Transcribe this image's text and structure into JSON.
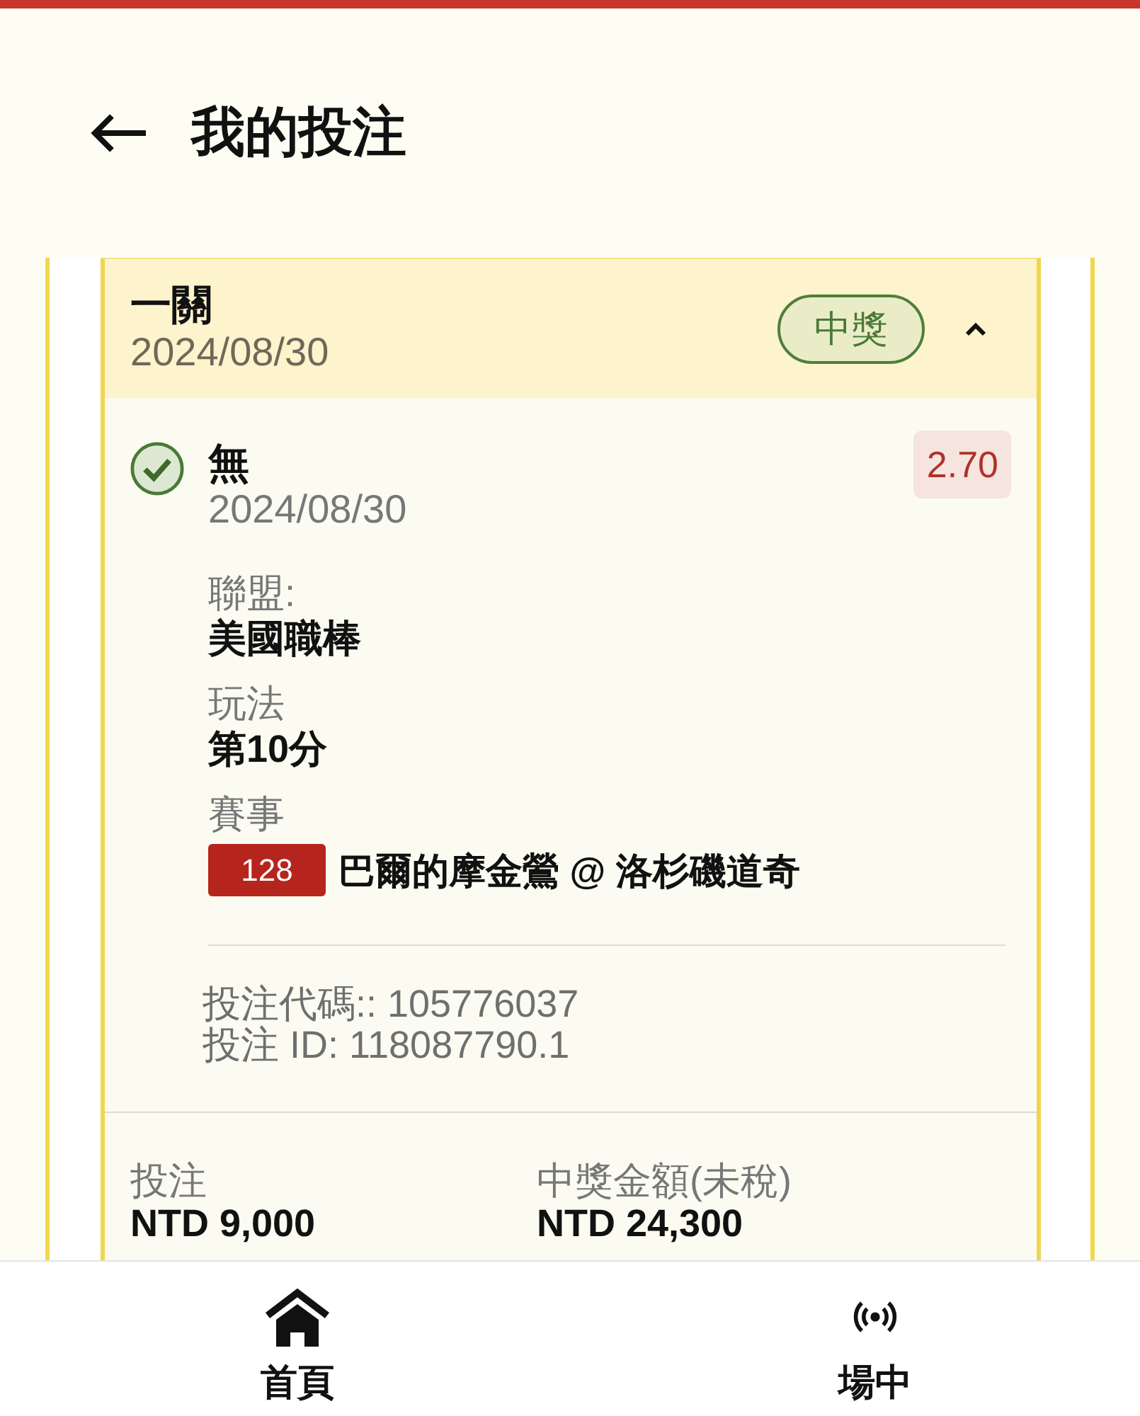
{
  "header": {
    "title": "我的投注"
  },
  "bet": {
    "title": "一關",
    "date": "2024/08/30",
    "status": "中獎",
    "expanded": true,
    "legs": [
      {
        "checked": true,
        "name": "無",
        "date": "2024/08/30",
        "odds": "2.70",
        "details": [
          {
            "label": "聯盟:",
            "value": "美國職棒"
          },
          {
            "label": "玩法",
            "value": "第10分"
          },
          {
            "label": "賽事",
            "event_number": "128",
            "value": "巴爾的摩金鶯 @ 洛杉磯道奇"
          }
        ],
        "codes": [
          "投注代碼:: 105776037",
          "投注 ID: 118087790.1"
        ]
      }
    ],
    "summary": [
      {
        "label": "投注",
        "value": "NTD 9,000"
      },
      {
        "label": "中獎金額(未稅)",
        "value": "NTD 24,300"
      }
    ]
  },
  "nav": [
    {
      "kind": "home",
      "label": "首頁"
    },
    {
      "kind": "live",
      "label": "場中"
    }
  ]
}
